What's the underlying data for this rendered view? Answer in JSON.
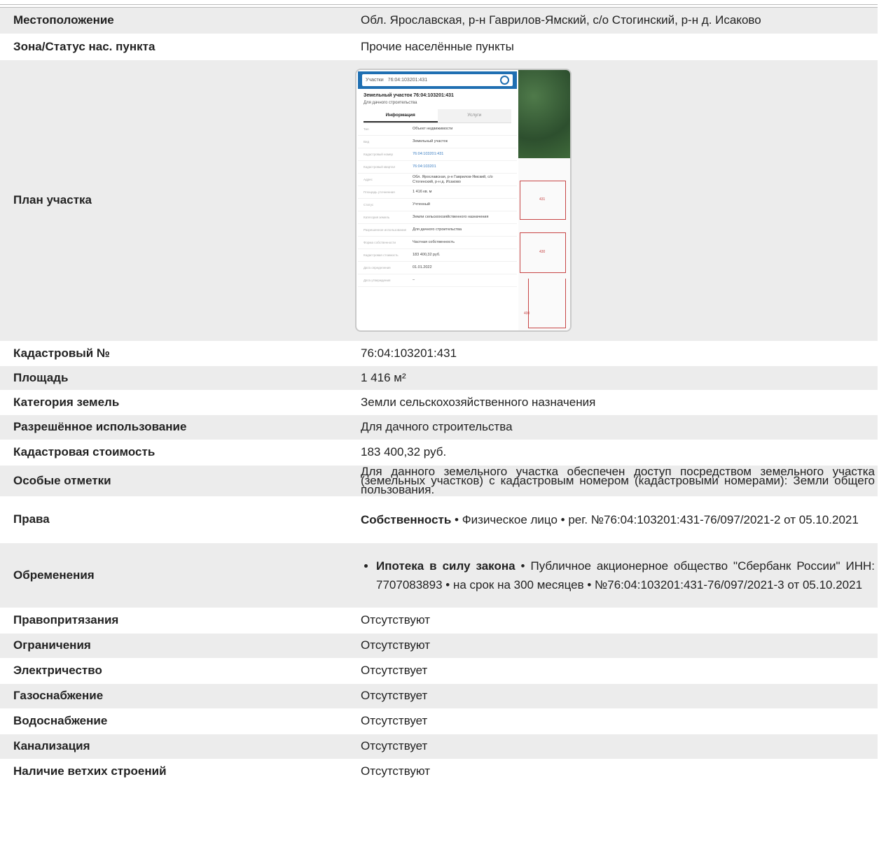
{
  "rows": [
    {
      "key": "Местоположение",
      "value": "Обл. Ярославская, р-н Гаврилов-Ямский, с/о Стогинский, р-н д. Исаково"
    },
    {
      "key": "Зона/Статус нас. пункта",
      "value": "Прочие населённые пункты"
    },
    {
      "key": "План участка"
    },
    {
      "key": "Кадастровый №",
      "value": "76:04:103201:431"
    },
    {
      "key": "Площадь",
      "value": "1 416 м²"
    },
    {
      "key": "Категория земель",
      "value": "Земли сельскохозяйственного назначения"
    },
    {
      "key": "Разрешённое использование",
      "value": "Для дачного строительства"
    },
    {
      "key": "Кадастровая стоимость",
      "value": "183 400,32 руб."
    },
    {
      "key": "Особые отметки",
      "value": "Для данного земельного участка обеспечен доступ посредством земельного участка (земельных участков) с кадастровым номером (кадастровыми номерами): Земли общего пользования."
    },
    {
      "key": "Права",
      "value_bold": "Собственность",
      "value": " • Физическое лицо •  рег. №76:04:103201:431-76/097/2021-2 от 05.10.2021"
    },
    {
      "key": "Обременения",
      "value_bold": "Ипотека в силу закона",
      "value": " • Публичное акционерное общество \"Сбербанк России\" ИНН: 7707083893 • на срок на 300 месяцев • №76:04:103201:431-76/097/2021-3 от 05.10.2021"
    },
    {
      "key": "Правопритязания",
      "value": "Отсутствуют"
    },
    {
      "key": "Ограничения",
      "value": "Отсутствуют"
    },
    {
      "key": "Электричество",
      "value": "Отсутствует"
    },
    {
      "key": "Газоснабжение",
      "value": "Отсутствует"
    },
    {
      "key": "Водоснабжение",
      "value": "Отсутствует"
    },
    {
      "key": "Канализация",
      "value": "Отсутствует"
    },
    {
      "key": "Наличие ветхих строений",
      "value": "Отсутствуют"
    }
  ],
  "plan": {
    "search_type": "Участки",
    "search_value": "76:04:103201:431",
    "title": "Земельный участок 76:04:103201:431",
    "purpose": "Для дачного строительства",
    "tab_info": "Информация",
    "tab_services": "Услуги",
    "fields": [
      {
        "l": "Тип",
        "r": "Объект недвижимости"
      },
      {
        "l": "Вид",
        "r": "Земельный участок"
      },
      {
        "l": "Кадастровый номер",
        "r": "76:04:103201:431",
        "link": true
      },
      {
        "l": "Кадастровый квартал",
        "r": "76:04:103201",
        "link": true
      },
      {
        "l": "Адрес",
        "r": "Обл. Ярославская, р-н Гаврилов-Ямский, с/о Стогинский, р-н д. Исаково"
      },
      {
        "l": "Площадь уточненная",
        "r": "1 416 кв. м"
      },
      {
        "l": "Статус",
        "r": "Учтенный"
      },
      {
        "l": "Категория земель",
        "r": "Земли сельскохозяйственного назначения"
      },
      {
        "l": "Разрешенное использование",
        "r": "Для дачного строительства"
      },
      {
        "l": "Форма собственности",
        "r": "Частная собственность"
      },
      {
        "l": "Кадастровая стоимость",
        "r": "183 400,32 руб."
      },
      {
        "l": "Дата определения",
        "r": "01.01.2022"
      },
      {
        "l": "Дата утверждения",
        "r": "–"
      }
    ],
    "lots": [
      "431",
      "430",
      "400"
    ],
    "colors": {
      "header": "#1f6fb2",
      "parcel": "#c74545"
    }
  }
}
